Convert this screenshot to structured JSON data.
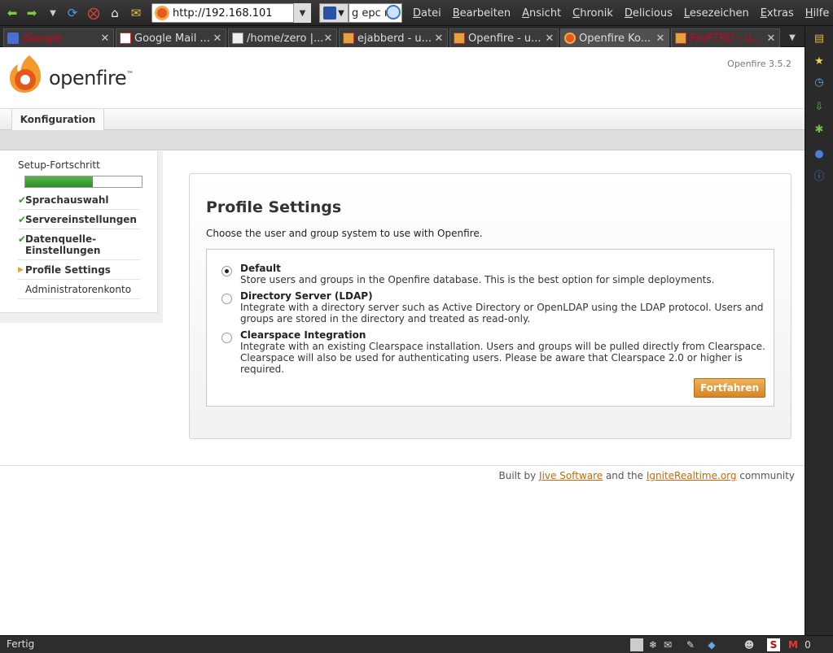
{
  "browser": {
    "url": "http://192.168.101",
    "search_text": "g epc r",
    "menu": [
      "Datei",
      "Bearbeiten",
      "Ansicht",
      "Chronik",
      "Delicious",
      "Lesezeichen",
      "Extras",
      "Hilfe"
    ],
    "tabs": [
      {
        "label": "iGoogle",
        "color": "#d0021b"
      },
      {
        "label": "Google Mail ...",
        "color": "#dddddd"
      },
      {
        "label": "/home/zero |...",
        "color": "#dddddd"
      },
      {
        "label": "ejabberd - u...",
        "color": "#dddddd"
      },
      {
        "label": "Openfire - u...",
        "color": "#dddddd"
      },
      {
        "label": "Openfire Ko...",
        "color": "#dddddd"
      },
      {
        "label": "ProFTPD - u...",
        "color": "#d0021b"
      }
    ],
    "status": "Fertig",
    "mail_count": "0"
  },
  "header": {
    "logo_text": "openfire",
    "logo_tm": "™",
    "version": "Openfire 3.5.2",
    "nav_tab": "Konfiguration"
  },
  "setup": {
    "title": "Setup-Fortschritt",
    "progress": 0.58,
    "steps": [
      {
        "label": "Sprachauswahl",
        "state": "done"
      },
      {
        "label": "Servereinstellungen",
        "state": "done"
      },
      {
        "label": "Datenquelle-Einstellungen",
        "state": "done"
      },
      {
        "label": "Profile Settings",
        "state": "current"
      },
      {
        "label": "Administratorenkonto",
        "state": "todo"
      }
    ]
  },
  "main": {
    "title": "Profile Settings",
    "subtitle": "Choose the user and group system to use with Openfire.",
    "options": [
      {
        "title": "Default",
        "desc": "Store users and groups in the Openfire database. This is the best option for simple deployments.",
        "checked": true
      },
      {
        "title": "Directory Server (LDAP)",
        "desc": "Integrate with a directory server such as Active Directory or OpenLDAP using the LDAP protocol. Users and groups are stored in the directory and treated as read-only.",
        "checked": false
      },
      {
        "title": "Clearspace Integration",
        "desc": "Integrate with an existing Clearspace installation. Users and groups will be pulled directly from Clearspace. Clearspace will also be used for authenticating users. Please be aware that Clearspace 2.0 or higher is required.",
        "checked": false
      }
    ],
    "continue_label": "Fortfahren"
  },
  "footer": {
    "prefix": "Built by ",
    "link1": "Jive Software",
    "middle": " and the ",
    "link2": "IgniteRealtime.org",
    "suffix": " community"
  }
}
